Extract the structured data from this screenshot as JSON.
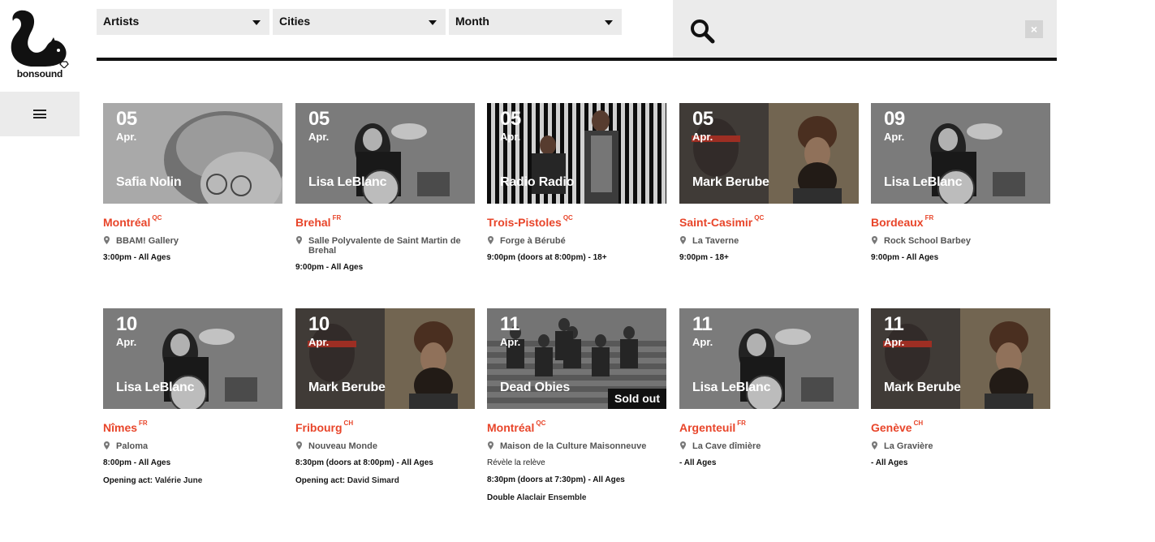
{
  "brand": {
    "name": "bonsound"
  },
  "filters": [
    {
      "label": "Artists"
    },
    {
      "label": "Cities"
    },
    {
      "label": "Month"
    }
  ],
  "search": {
    "placeholder": "",
    "clear_label": "×"
  },
  "colors": {
    "accent": "#e8452a",
    "panel": "#ebebeb",
    "ink": "#111111"
  },
  "events": [
    {
      "day": "05",
      "month": "Apr.",
      "artist": "Safia Nolin",
      "city": "Montréal",
      "region": "QC",
      "venue": "BBAM! Gallery",
      "time": "3:00pm - All Ages",
      "image": "portrait-short-hair"
    },
    {
      "day": "05",
      "month": "Apr.",
      "artist": "Lisa LeBlanc",
      "city": "Brehal",
      "region": "FR",
      "venue": "Salle Polyvalente de Saint Martin de Brehal",
      "time": "9:00pm - All Ages",
      "image": "banjo-portrait"
    },
    {
      "day": "05",
      "month": "Apr.",
      "artist": "Radio Radio",
      "city": "Trois-Pistoles",
      "region": "QC",
      "venue": "Forge à Bérubé",
      "time": "9:00pm (doors at 8:00pm) - 18+",
      "image": "striped-duo"
    },
    {
      "day": "05",
      "month": "Apr.",
      "artist": "Mark Berube",
      "city": "Saint-Casimir",
      "region": "QC",
      "venue": "La Taverne",
      "time": "9:00pm - 18+",
      "image": "duo-red"
    },
    {
      "day": "09",
      "month": "Apr.",
      "artist": "Lisa LeBlanc",
      "city": "Bordeaux",
      "region": "FR",
      "venue": "Rock School Barbey",
      "time": "9:00pm - All Ages",
      "image": "banjo-portrait"
    },
    {
      "day": "10",
      "month": "Apr.",
      "artist": "Lisa LeBlanc",
      "city": "Nîmes",
      "region": "FR",
      "venue": "Paloma",
      "time": "8:00pm - All Ages",
      "extra_label": "Opening act:",
      "extra_value": "Valérie June",
      "image": "banjo-portrait"
    },
    {
      "day": "10",
      "month": "Apr.",
      "artist": "Mark Berube",
      "city": "Fribourg",
      "region": "CH",
      "venue": "Nouveau Monde",
      "time": "8:30pm (doors at 8:00pm) - All Ages",
      "extra_label": "Opening act:",
      "extra_value": "David Simard",
      "image": "duo-red"
    },
    {
      "day": "11",
      "month": "Apr.",
      "artist": "Dead Obies",
      "city": "Montréal",
      "region": "QC",
      "venue": "Maison de la Culture Maisonneuve",
      "subtitle": "Révèle la relève",
      "time": "8:30pm (doors at 7:30pm) - All Ages",
      "extra_label": "Double",
      "extra_value": "Alaclair Ensemble",
      "sold_out": "Sold out",
      "image": "group-stairs"
    },
    {
      "day": "11",
      "month": "Apr.",
      "artist": "Lisa LeBlanc",
      "city": "Argenteuil",
      "region": "FR",
      "venue": "La Cave dîmière",
      "time": "- All Ages",
      "image": "banjo-portrait"
    },
    {
      "day": "11",
      "month": "Apr.",
      "artist": "Mark Berube",
      "city": "Genève",
      "region": "CH",
      "venue": "La Gravière",
      "time": "- All Ages",
      "image": "duo-red"
    }
  ]
}
